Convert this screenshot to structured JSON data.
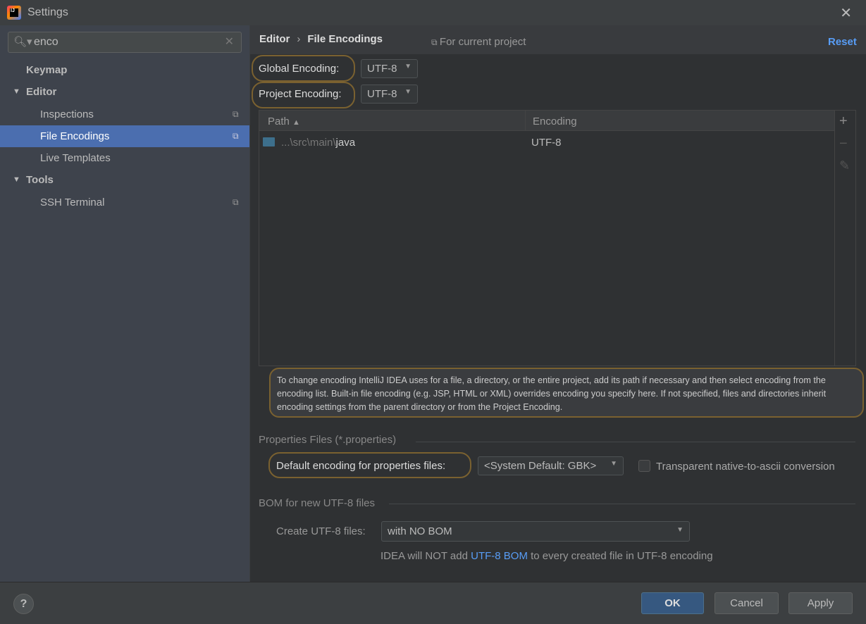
{
  "window": {
    "title": "Settings",
    "close": "✕"
  },
  "search": {
    "value": "enco",
    "icon": "search-icon",
    "clear": "✕"
  },
  "sidebar": {
    "items": [
      {
        "label": "Keymap"
      },
      {
        "label": "Editor",
        "expanded": true
      },
      {
        "label": "Inspections"
      },
      {
        "label": "File Encodings",
        "selected": true
      },
      {
        "label": "Live Templates"
      },
      {
        "label": "Tools",
        "expanded": true
      },
      {
        "label": "SSH Terminal"
      }
    ]
  },
  "header": {
    "breadcrumb": [
      "Editor",
      "File Encodings"
    ],
    "separator": "›",
    "scope": "For current project",
    "reset": "Reset"
  },
  "global_encoding": {
    "label": "Global Encoding:",
    "value": "UTF-8"
  },
  "project_encoding": {
    "label": "Project Encoding:",
    "value": "UTF-8"
  },
  "table": {
    "columns": [
      "Path",
      "Encoding"
    ],
    "sort_indicator": "▲",
    "rows": [
      {
        "path_prefix": "...\\src\\main\\",
        "path_name": "java",
        "encoding": "UTF-8"
      }
    ],
    "tools": {
      "add": "+",
      "remove": "−",
      "edit": "✎"
    }
  },
  "info_text": "To change encoding IntelliJ IDEA uses for a file, a directory, or the entire project, add its path if necessary and then select encoding from the encoding list. Built-in file encoding (e.g. JSP, HTML or XML) overrides encoding you specify here. If not specified, files and directories inherit encoding settings from the parent directory or from the Project Encoding.",
  "properties": {
    "section": "Properties Files (*.properties)",
    "label": "Default encoding for properties files:",
    "value": "<System Default: GBK>",
    "checkbox_label": "Transparent native-to-ascii conversion",
    "checked": false
  },
  "bom": {
    "section": "BOM for new UTF-8 files",
    "label": "Create UTF-8 files:",
    "value": "with NO BOM",
    "note_before": "IDEA will NOT add ",
    "note_link": "UTF-8 BOM",
    "note_after": " to every created file in UTF-8 encoding"
  },
  "footer": {
    "help": "?",
    "ok": "OK",
    "cancel": "Cancel",
    "apply": "Apply"
  },
  "colors": {
    "accent": "#4b6eaf",
    "link": "#589df6",
    "highlight": "#7a6130"
  }
}
